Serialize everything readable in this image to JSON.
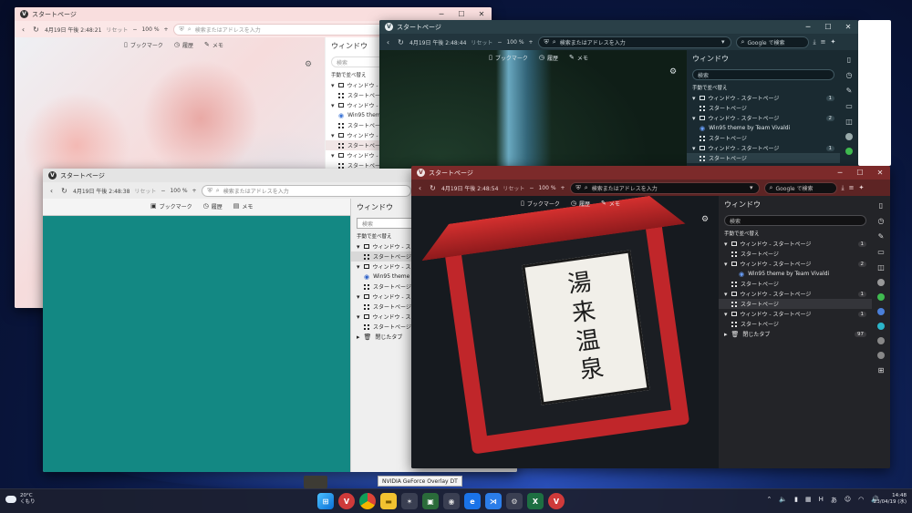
{
  "browser": {
    "tab_title": "スタートページ",
    "reset_label": "リセット",
    "zoom": "100 %",
    "address_placeholder": "検索またはアドレスを入力",
    "search_engine": "Google で検索",
    "speed_links": [
      "ブックマーク",
      "履歴",
      "メモ"
    ],
    "panel_title": "ウィンドウ",
    "panel_filter_placeholder": "検索",
    "panel_sort": "手動で並べ替え",
    "window_item": "ウィンドウ - スタートページ",
    "page_item": "スタートページ",
    "win95_item": "Win95 theme by Team Vivaldi",
    "closed_tabs": "閉じたタブ",
    "closed_tabs_count": "97"
  },
  "windows": {
    "pink": {
      "clock": "4月19日 午後 2:48:21"
    },
    "teal": {
      "clock": "4月19日 午後 2:48:38"
    },
    "dark": {
      "clock": "4月19日 午後 2:48:44"
    },
    "red": {
      "clock": "4月19日 午後 2:48:54"
    }
  },
  "tree_badges": {
    "dark": [
      "1",
      "2",
      "1"
    ],
    "red": [
      "1",
      "2",
      "1",
      "1"
    ]
  },
  "sign_text": [
    "湯",
    "来",
    "温",
    "泉"
  ],
  "taskbar": {
    "weather_temp": "20°C",
    "weather_cond": "くもり",
    "tooltip": "NVIDIA GeForce Overlay DT",
    "time": "14:48",
    "date": "23/04/19 (水)",
    "tray_ime": "あ",
    "tray_h": "H"
  },
  "colors": {
    "vivaldi_red": "#ef3939",
    "pink_theme": "#f9dede",
    "teal_theme": "#138883",
    "dark_theme": "#2a4048",
    "red_theme": "#7c2a2a"
  }
}
